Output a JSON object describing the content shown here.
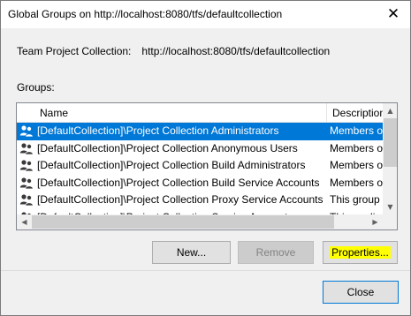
{
  "window": {
    "title": "Global Groups on http://localhost:8080/tfs/defaultcollection",
    "close_glyph": "✕"
  },
  "tpc": {
    "label": "Team Project Collection:",
    "value": "http://localhost:8080/tfs/defaultcollection"
  },
  "groups_label": "Groups:",
  "list": {
    "columns": {
      "name": "Name",
      "description": "Description"
    },
    "rows": [
      {
        "name": "[DefaultCollection]\\Project Collection Administrators",
        "description": "Members of",
        "selected": true
      },
      {
        "name": "[DefaultCollection]\\Project Collection Anonymous Users",
        "description": "Members of"
      },
      {
        "name": "[DefaultCollection]\\Project Collection Build Administrators",
        "description": "Members of"
      },
      {
        "name": "[DefaultCollection]\\Project Collection Build Service Accounts",
        "description": "Members of"
      },
      {
        "name": "[DefaultCollection]\\Project Collection Proxy Service Accounts",
        "description": "This group"
      },
      {
        "name": "[DefaultCollection]\\Project Collection Service Accounts",
        "description": "This applica"
      }
    ],
    "icon": "group-icon"
  },
  "buttons": {
    "new": "New...",
    "remove": "Remove",
    "properties": "Properties...",
    "close": "Close"
  },
  "colors": {
    "selection": "#0078d7",
    "highlight": "#ffff00"
  }
}
